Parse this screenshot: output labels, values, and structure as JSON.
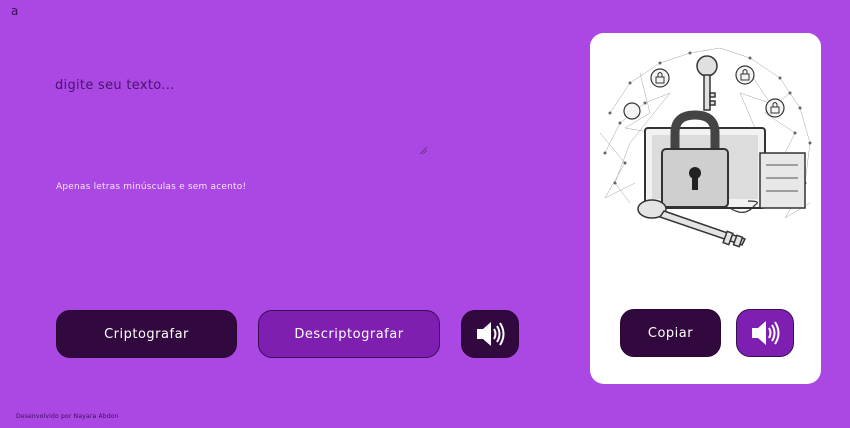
{
  "logo": {
    "text": "a"
  },
  "input": {
    "placeholder": "digite seu texto..."
  },
  "hint": "Apenas letras minúsculas e sem acento!",
  "buttons": {
    "encrypt": "Criptografar",
    "decrypt": "Descriptografar",
    "copy": "Copiar"
  },
  "icons": {
    "speaker": "speaker-icon",
    "illustration": "lock-key-network-illustration"
  },
  "footer": "Desenvolvido por Nayara Abdon",
  "colors": {
    "background": "#ab47e2",
    "dark_button": "#32093f",
    "purple_button": "#7e1fb1",
    "panel": "#ffffff",
    "text_dark": "#3a0e56"
  }
}
